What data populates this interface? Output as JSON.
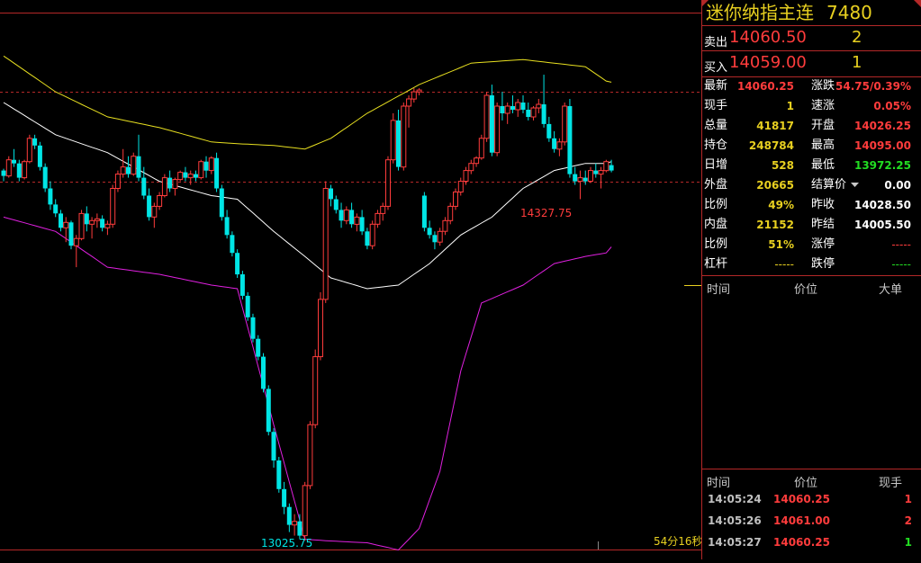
{
  "header": {
    "name": "迷你纳指主连",
    "code": "7480"
  },
  "quote": {
    "sell_label": "卖出",
    "sell_price": "14060.50",
    "sell_vol": "2",
    "buy_label": "买入",
    "buy_price": "14059.00",
    "buy_vol": "1"
  },
  "stats_left": [
    {
      "label": "最新",
      "value": "14060.25",
      "color": "red"
    },
    {
      "label": "现手",
      "value": "1",
      "color": "yellow"
    },
    {
      "label": "总量",
      "value": "41817",
      "color": "yellow"
    },
    {
      "label": "持仓",
      "value": "248784",
      "color": "yellow"
    },
    {
      "label": "日增",
      "value": "528",
      "color": "yellow"
    },
    {
      "label": "外盘",
      "value": "20665",
      "color": "yellow"
    },
    {
      "label": "比例",
      "value": "49%",
      "color": "yellow"
    },
    {
      "label": "内盘",
      "value": "21152",
      "color": "yellow"
    },
    {
      "label": "比例",
      "value": "51%",
      "color": "yellow"
    },
    {
      "label": "杠杆",
      "value": "-----",
      "color": "yellow"
    }
  ],
  "stats_right": [
    {
      "label": "涨跌",
      "value": "54.75/0.39%",
      "color": "red"
    },
    {
      "label": "速涨",
      "value": "0.05%",
      "color": "red"
    },
    {
      "label": "开盘",
      "value": "14026.25",
      "color": "red"
    },
    {
      "label": "最高",
      "value": "14095.00",
      "color": "red"
    },
    {
      "label": "最低",
      "value": "13972.25",
      "color": "green"
    },
    {
      "label": "结算价",
      "value": "0.00",
      "color": "white"
    },
    {
      "label": "昨收",
      "value": "14028.50",
      "color": "white"
    },
    {
      "label": "昨结",
      "value": "14005.50",
      "color": "white"
    },
    {
      "label": "涨停",
      "value": "-----",
      "color": "red"
    },
    {
      "label": "跌停",
      "value": "-----",
      "color": "green"
    }
  ],
  "big_orders": {
    "col_time": "时间",
    "col_price": "价位",
    "col_big": "大单"
  },
  "ticks": {
    "col_time": "时间",
    "col_price": "价位",
    "col_vol": "现手",
    "rows": [
      {
        "time": "14:05:24",
        "price": "14060.25",
        "vol": "1",
        "vol_color": "red"
      },
      {
        "time": "14:05:26",
        "price": "14061.00",
        "vol": "2",
        "vol_color": "red"
      },
      {
        "time": "14:05:27",
        "price": "14060.25",
        "vol": "1",
        "vol_color": "green"
      }
    ]
  },
  "chart_labels": {
    "high_label": "14327.75",
    "low_label": "13025.75",
    "countdown": "54分16秒"
  },
  "colors": {
    "up": "#ff3c3c",
    "down": "#00e5e5",
    "mid": "#ffffff",
    "upper": "#e8e020",
    "lower": "#e020e0",
    "grid": "#b42828"
  },
  "chart_data": {
    "type": "candlestick",
    "price_range": [
      13000,
      14500
    ],
    "dashed_levels": [
      14280,
      14028.5
    ],
    "candles": [
      [
        14060,
        14065,
        14030,
        14045
      ],
      [
        14045,
        14100,
        14040,
        14090
      ],
      [
        14090,
        14120,
        14070,
        14080
      ],
      [
        14080,
        14090,
        14030,
        14040
      ],
      [
        14040,
        14090,
        14035,
        14085
      ],
      [
        14085,
        14160,
        14080,
        14150
      ],
      [
        14150,
        14160,
        14120,
        14130
      ],
      [
        14130,
        14140,
        14060,
        14070
      ],
      [
        14070,
        14080,
        14000,
        14010
      ],
      [
        14010,
        14030,
        13950,
        13965
      ],
      [
        13965,
        13980,
        13930,
        13940
      ],
      [
        13940,
        13950,
        13890,
        13900
      ],
      [
        13900,
        13930,
        13860,
        13915
      ],
      [
        13915,
        13920,
        13840,
        13850
      ],
      [
        13850,
        13880,
        13790,
        13870
      ],
      [
        13870,
        13950,
        13865,
        13940
      ],
      [
        13940,
        13960,
        13890,
        13910
      ],
      [
        13910,
        13930,
        13870,
        13920
      ],
      [
        13920,
        13940,
        13900,
        13925
      ],
      [
        13925,
        13935,
        13890,
        13900
      ],
      [
        13900,
        13920,
        13880,
        13910
      ],
      [
        13910,
        14020,
        13900,
        14010
      ],
      [
        14010,
        14060,
        14000,
        14050
      ],
      [
        14050,
        14120,
        14040,
        14070
      ],
      [
        14070,
        14100,
        14040,
        14050
      ],
      [
        14050,
        14110,
        14045,
        14100
      ],
      [
        14100,
        14160,
        14030,
        14040
      ],
      [
        14040,
        14070,
        13980,
        13990
      ],
      [
        13990,
        14010,
        13920,
        13930
      ],
      [
        13930,
        13970,
        13900,
        13960
      ],
      [
        13960,
        14000,
        13950,
        13990
      ],
      [
        13990,
        14050,
        13985,
        14040
      ],
      [
        14040,
        14060,
        14000,
        14010
      ],
      [
        14010,
        14040,
        13990,
        14035
      ],
      [
        14035,
        14060,
        14030,
        14055
      ],
      [
        14055,
        14070,
        14030,
        14040
      ],
      [
        14040,
        14060,
        14020,
        14050
      ],
      [
        14050,
        14060,
        14030,
        14040
      ],
      [
        14040,
        14090,
        14035,
        14085
      ],
      [
        14085,
        14100,
        14040,
        14060
      ],
      [
        14060,
        14100,
        14050,
        14095
      ],
      [
        14095,
        14110,
        14000,
        14010
      ],
      [
        14010,
        14020,
        13920,
        13930
      ],
      [
        13930,
        13950,
        13870,
        13880
      ],
      [
        13880,
        13890,
        13820,
        13830
      ],
      [
        13830,
        13840,
        13760,
        13770
      ],
      [
        13770,
        13780,
        13700,
        13710
      ],
      [
        13710,
        13720,
        13640,
        13650
      ],
      [
        13650,
        13660,
        13580,
        13590
      ],
      [
        13590,
        13600,
        13530,
        13540
      ],
      [
        13540,
        13550,
        13440,
        13450
      ],
      [
        13450,
        13460,
        13320,
        13330
      ],
      [
        13330,
        13340,
        13230,
        13250
      ],
      [
        13250,
        13260,
        13160,
        13170
      ],
      [
        13170,
        13190,
        13100,
        13120
      ],
      [
        13120,
        13130,
        13050,
        13070
      ],
      [
        13070,
        13100,
        13040,
        13080
      ],
      [
        13080,
        13100,
        13030,
        13040
      ],
      [
        13040,
        13190,
        13025.75,
        13180
      ],
      [
        13180,
        13360,
        13170,
        13350
      ],
      [
        13350,
        13560,
        13340,
        13540
      ],
      [
        13540,
        13720,
        13530,
        13700
      ],
      [
        13700,
        14030,
        13690,
        14010
      ],
      [
        14010,
        14020,
        13960,
        13980
      ],
      [
        13980,
        13990,
        13940,
        13950
      ],
      [
        13950,
        13970,
        13900,
        13920
      ],
      [
        13920,
        13960,
        13910,
        13950
      ],
      [
        13950,
        13970,
        13900,
        13910
      ],
      [
        13910,
        13940,
        13890,
        13930
      ],
      [
        13930,
        13950,
        13880,
        13890
      ],
      [
        13890,
        13900,
        13840,
        13850
      ],
      [
        13850,
        13920,
        13840,
        13910
      ],
      [
        13910,
        13950,
        13900,
        13940
      ],
      [
        13940,
        13970,
        13920,
        13960
      ],
      [
        13960,
        14100,
        13950,
        14090
      ],
      [
        14090,
        14220,
        14080,
        14200
      ],
      [
        14200,
        14230,
        14060,
        14070
      ],
      [
        14070,
        14250,
        14060,
        14240
      ],
      [
        14240,
        14270,
        14180,
        14260
      ],
      [
        14260,
        14290,
        14250,
        14280
      ],
      [
        14280,
        14290,
        14270,
        14285
      ],
      [
        13990,
        14000,
        13890,
        13900
      ],
      [
        13900,
        13920,
        13870,
        13880
      ],
      [
        13880,
        13890,
        13840,
        13860
      ],
      [
        13860,
        13900,
        13850,
        13890
      ],
      [
        13890,
        13930,
        13880,
        13920
      ],
      [
        13920,
        13970,
        13910,
        13960
      ],
      [
        13960,
        14010,
        13950,
        14000
      ],
      [
        14000,
        14040,
        13990,
        14030
      ],
      [
        14030,
        14070,
        14020,
        14060
      ],
      [
        14060,
        14090,
        14050,
        14080
      ],
      [
        14080,
        14100,
        14070,
        14095
      ],
      [
        14095,
        14160,
        14090,
        14150
      ],
      [
        14150,
        14280,
        14140,
        14270
      ],
      [
        14270,
        14300,
        14100,
        14110
      ],
      [
        14110,
        14250,
        14100,
        14240
      ],
      [
        14240,
        14280,
        14200,
        14220
      ],
      [
        14220,
        14250,
        14190,
        14240
      ],
      [
        14240,
        14270,
        14220,
        14230
      ],
      [
        14230,
        14260,
        14210,
        14250
      ],
      [
        14250,
        14270,
        14220,
        14230
      ],
      [
        14230,
        14250,
        14200,
        14210
      ],
      [
        14210,
        14240,
        14200,
        14235
      ],
      [
        14235,
        14260,
        14220,
        14245
      ],
      [
        14245,
        14327.75,
        14180,
        14190
      ],
      [
        14190,
        14210,
        14140,
        14150
      ],
      [
        14150,
        14170,
        14110,
        14120
      ],
      [
        14120,
        14150,
        14100,
        14140
      ],
      [
        14140,
        14250,
        14130,
        14240
      ],
      [
        14240,
        14260,
        14040,
        14050
      ],
      [
        14050,
        14070,
        14020,
        14030
      ],
      [
        14030,
        14060,
        13980,
        14040
      ],
      [
        14040,
        14060,
        14020,
        14030
      ],
      [
        14030,
        14070,
        14025,
        14060
      ],
      [
        14060,
        14080,
        14040,
        14050
      ],
      [
        14050,
        14070,
        14010,
        14060
      ],
      [
        14060,
        14090,
        14055,
        14085
      ],
      [
        14075,
        14090,
        14055,
        14060
      ]
    ],
    "upper_band_keypoints": [
      [
        0,
        14380
      ],
      [
        10,
        14280
      ],
      [
        20,
        14210
      ],
      [
        30,
        14180
      ],
      [
        40,
        14140
      ],
      [
        45,
        14135
      ],
      [
        52,
        14130
      ],
      [
        58,
        14120
      ],
      [
        63,
        14150
      ],
      [
        70,
        14220
      ],
      [
        80,
        14300
      ],
      [
        90,
        14360
      ],
      [
        100,
        14370
      ],
      [
        106,
        14360
      ],
      [
        112,
        14350
      ],
      [
        116,
        14310
      ],
      [
        119,
        14300
      ]
    ],
    "mid_band_keypoints": [
      [
        0,
        14250
      ],
      [
        10,
        14160
      ],
      [
        20,
        14110
      ],
      [
        30,
        14030
      ],
      [
        40,
        13990
      ],
      [
        45,
        13980
      ],
      [
        52,
        13890
      ],
      [
        58,
        13820
      ],
      [
        63,
        13760
      ],
      [
        70,
        13730
      ],
      [
        76,
        13740
      ],
      [
        82,
        13800
      ],
      [
        88,
        13880
      ],
      [
        94,
        13930
      ],
      [
        100,
        14010
      ],
      [
        106,
        14060
      ],
      [
        112,
        14080
      ],
      [
        116,
        14080
      ],
      [
        119,
        14095
      ]
    ],
    "lower_band_keypoints": [
      [
        0,
        13930
      ],
      [
        10,
        13890
      ],
      [
        20,
        13790
      ],
      [
        30,
        13770
      ],
      [
        40,
        13740
      ],
      [
        45,
        13730
      ],
      [
        52,
        13350
      ],
      [
        58,
        13030
      ],
      [
        63,
        13025
      ],
      [
        70,
        13020
      ],
      [
        76,
        13000
      ],
      [
        80,
        13060
      ],
      [
        84,
        13220
      ],
      [
        88,
        13500
      ],
      [
        92,
        13690
      ],
      [
        100,
        13740
      ],
      [
        106,
        13800
      ],
      [
        112,
        13820
      ],
      [
        116,
        13830
      ],
      [
        119,
        13880
      ]
    ]
  }
}
